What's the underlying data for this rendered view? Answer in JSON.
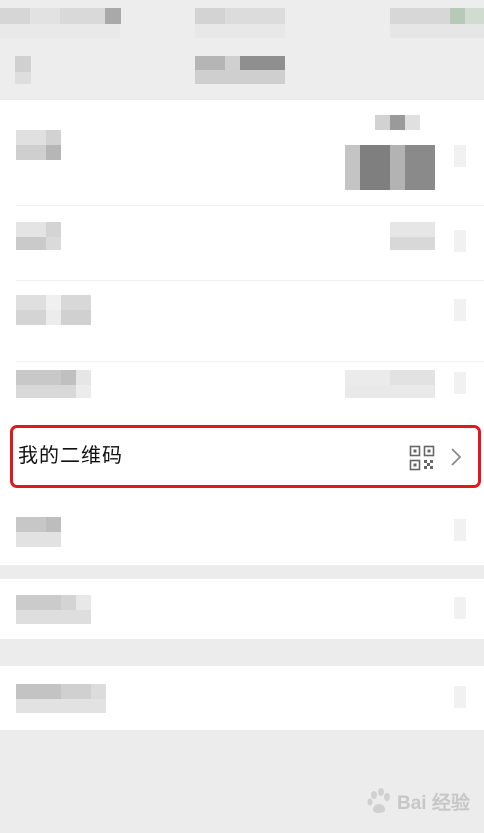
{
  "menu": {
    "qr_item_label": "我的二维码"
  },
  "watermark": {
    "text": "Bai 经验"
  },
  "icons": {
    "qr": "qr-code-icon",
    "chevron": "chevron-right-icon",
    "watermark_logo": "baidu-paw-icon"
  },
  "colors": {
    "highlight": "#e4171a",
    "background": "#ececec",
    "row": "#ffffff"
  }
}
